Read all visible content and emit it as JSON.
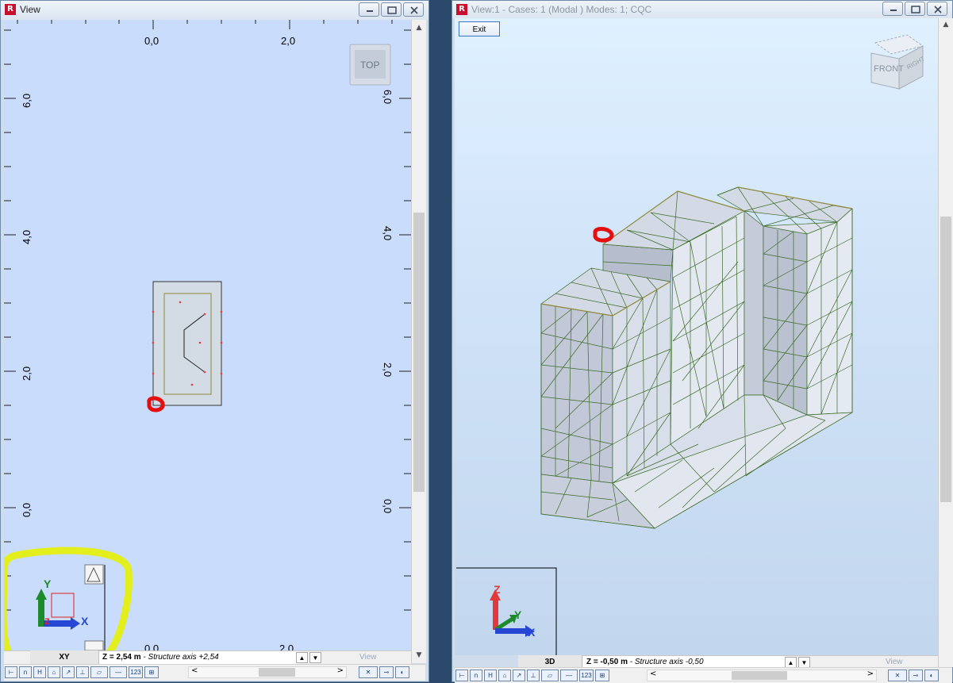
{
  "left_window": {
    "title": "View",
    "view_cube_label": "TOP",
    "ruler_x_labels": [
      "0,0",
      "2,0"
    ],
    "ruler_y_labels": [
      "6,0",
      "4,0",
      "2,0",
      "0,0"
    ],
    "ruler_y_labels_right": [
      "6,0",
      "4,0",
      "2,0",
      "0,0"
    ],
    "bottom_partial_labels": [
      "0,0",
      "2,0"
    ],
    "axis_x": "X",
    "axis_y": "Y",
    "axis_z": "Z",
    "plane_label": "XY",
    "level_text": "Z = 2,54 m",
    "level_suffix": " - Structure axis +2,54",
    "view_label": "View",
    "nav_left": "<",
    "nav_right": ">"
  },
  "right_window": {
    "title": "View:1 - Cases: 1 (Modal ) Modes: 1; CQC",
    "exit_label": "Exit",
    "view_cube_front": "FRONT",
    "view_cube_right": "RIGHT",
    "axis_x": "X",
    "axis_y": "Y",
    "axis_z": "Z",
    "plane_label": "3D",
    "level_text": "Z = -0,50 m",
    "level_suffix": " - Structure axis -0,50",
    "view_label": "View",
    "nav_left": "<",
    "nav_right": ">"
  },
  "toolbar_icons": [
    "node-icon",
    "bar-icon",
    "section-icon",
    "support-icon",
    "release-icon",
    "load-icon",
    "offset-icon",
    "panel-icon",
    "line-icon",
    "numbering-icon",
    "display-icon"
  ],
  "colors": {
    "canvas_2d": "#c9dcfb",
    "mesh_line": "#3a6b25",
    "annotation_red": "#e41010",
    "highlight_yellow": "#e3ef1c",
    "axis_x": "#2547d4",
    "axis_y": "#1d8a2c",
    "axis_z": "#e23a3a"
  }
}
